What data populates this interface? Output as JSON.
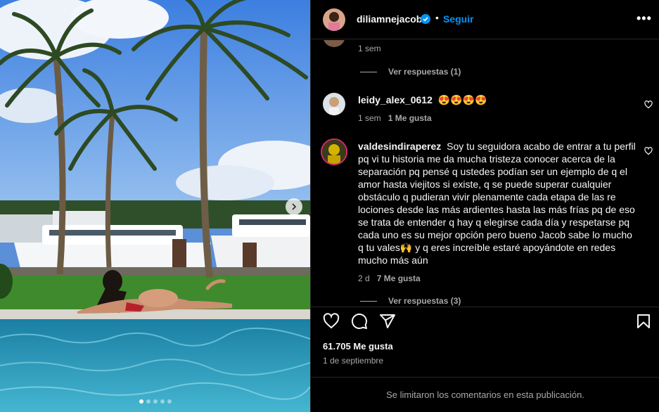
{
  "post": {
    "images_count": 5,
    "current_image": 1,
    "header": {
      "username": "diliamnejacob",
      "separator": "•",
      "follow_label": "Seguir",
      "more_label": "•••"
    },
    "comments": [
      {
        "time": "1 sem",
        "replies_label": "Ver respuestas (1)"
      },
      {
        "username": "leidy_alex_0612",
        "text": "😍😍😍😍",
        "time": "1 sem",
        "likes": "1 Me gusta"
      },
      {
        "username": "valdesindiraperez",
        "text": "Soy tu seguidora acabo de entrar a tu perfil pq vi tu historia me da mucha tristeza conocer acerca de la separación pq pensé q ustedes podían ser un ejemplo de q el amor hasta viejitos si existe, q se puede superar cualquier obstáculo q pudieran vivir plenamente cada etapa de las re lociones desde las más ardientes hasta las más frías pq de eso se trata de entender q hay q elegirse cada día y respetarse pq cada uno es su mejor opción pero bueno Jacob sabe lo mucho q tu vales🙌 y q eres increíble estaré apoyándote en redes mucho más aún",
        "time": "2 d",
        "likes": "7 Me gusta",
        "replies_label": "Ver respuestas (3)"
      }
    ],
    "likes_count": "61.705 Me gusta",
    "date": "1 de septiembre",
    "comments_disabled": "Se limitaron los comentarios en esta publicación."
  },
  "colors": {
    "accent": "#0095f6",
    "secondary_text": "#a8a8a8",
    "divider": "#262626"
  },
  "icons": [
    "verified-badge-icon",
    "heart-icon",
    "comment-icon",
    "share-icon",
    "bookmark-icon",
    "chevron-right-icon",
    "more-options-icon"
  ]
}
